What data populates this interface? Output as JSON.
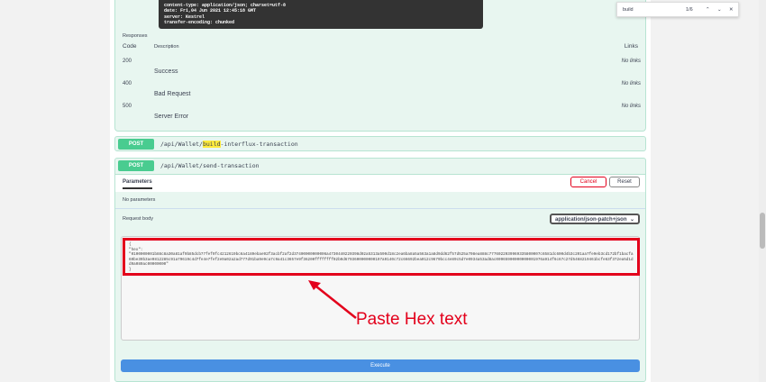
{
  "response_headers": [
    "content-type: application/json; charset=utf-8",
    "date: Fri,04 Jun 2021 12:45:18 GMT",
    "server: Kestrel",
    "transfer-encoding: chunked"
  ],
  "responses": {
    "title": "Responses",
    "code_header": "Code",
    "desc_header": "Description",
    "links_header": "Links",
    "rows": [
      {
        "code": "200",
        "desc": "Success",
        "links": "No links"
      },
      {
        "code": "400",
        "desc": "Bad Request",
        "links": "No links"
      },
      {
        "code": "500",
        "desc": "Server Error",
        "links": "No links"
      }
    ]
  },
  "ops": [
    {
      "method": "POST",
      "path_pre": "/api/Wallet/",
      "path_hl": "build",
      "path_post": "-interflux-transaction"
    },
    {
      "method": "POST",
      "path": "/api/Wallet/send-transaction"
    }
  ],
  "params": {
    "tab": "Parameters",
    "cancel": "Cancel",
    "reset": "Reset",
    "none": "No parameters",
    "request_body": "Request body",
    "content_type": "application/json-patch+json"
  },
  "body": {
    "open": "{",
    "key": "  \"hex\":",
    "value": "\"0100000001b88c8a30a81af9b85dcb77fef9fc4212619bc6a4189ebae92f3acbf2af2d37400000000006a4730440220398d02a5313a590d18c2ea6ba8a5a563a1a8d9dd62f57d525a708ea888c7776022039969335800007c6581dc600d4b3c201aa7fe9eb3cd172bf1bacfa60be39b3ae9812285c91a79619c4d7fe4e7fef2e9a02a2ad777d91ba9e9ca7c9a41c3657e9f36200ffffffff02b0d6793600000000197a9140c72c66692bea012c9679bcc4e89c5d7e0934a53ad8ac00965900000000001976a914f6c67c27d5468219461bcfe63f372ea5d1dd9a080ac00000000\"",
    "close": "}"
  },
  "execute": "Execute",
  "find": {
    "query": "build",
    "count": "1/6"
  },
  "annotation": "Paste Hex text",
  "colors": {
    "post": "#49cc90",
    "highlight": "#e3001b"
  }
}
